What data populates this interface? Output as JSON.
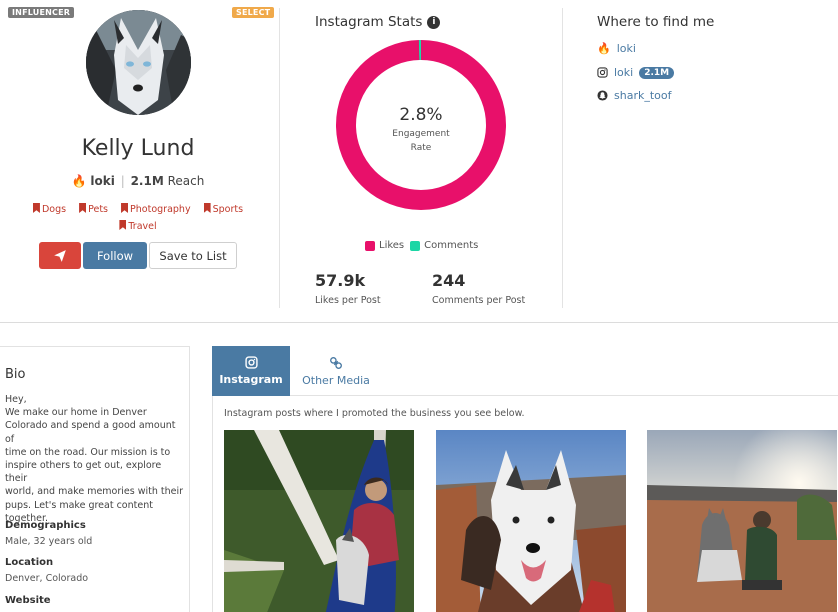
{
  "profile": {
    "badge_left": "INFLUENCER",
    "badge_right": "SELECT",
    "name": "Kelly Lund",
    "handle": "loki",
    "reach_value": "2.1M",
    "reach_label": "Reach",
    "tags": [
      "Dogs",
      "Pets",
      "Photography",
      "Sports",
      "Travel"
    ],
    "follow_label": "Follow",
    "save_label": "Save to List"
  },
  "stats": {
    "title": "Instagram Stats",
    "engagement_value": "2.8%",
    "engagement_label_1": "Engagement",
    "engagement_label_2": "Rate",
    "legend": [
      {
        "label": "Likes",
        "color": "#e8106a"
      },
      {
        "label": "Comments",
        "color": "#1bd6a5"
      }
    ],
    "likes_share": 0.996,
    "likes_value": "57.9k",
    "likes_label": "Likes per Post",
    "comments_value": "244",
    "comments_label": "Comments per Post"
  },
  "where": {
    "title": "Where to find me",
    "rows": [
      {
        "icon": "fire-icon",
        "label": "loki"
      },
      {
        "icon": "instagram-icon",
        "label": "loki",
        "count": "2.1M"
      },
      {
        "icon": "snapchat-icon",
        "label": "shark_toof"
      }
    ]
  },
  "bio": {
    "title": "Bio",
    "text": "Hey,\nWe make our home in Denver\nColorado and spend a good amount of\ntime on the road. Our mission is to\ninspire others to get out, explore their\nworld, and make memories with their\npups. Let's make great content\ntogether.",
    "demographics_title": "Demographics",
    "demographics_value": "Male, 32 years old",
    "location_title": "Location",
    "location_value": "Denver, Colorado",
    "website_title": "Website"
  },
  "media": {
    "tabs": [
      "Instagram",
      "Other Media"
    ],
    "promo_text": "Instagram posts where I promoted the business you see below."
  },
  "colors": {
    "accent": "#4a7aa3",
    "danger": "#d9453b",
    "tag": "#c0392b"
  }
}
